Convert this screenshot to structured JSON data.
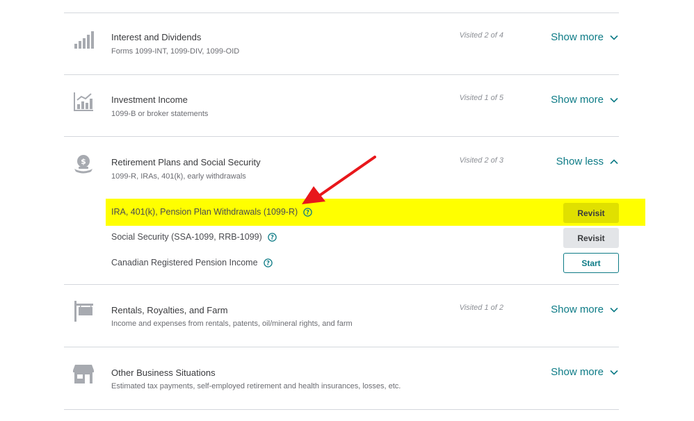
{
  "colors": {
    "accent": "#0d7b86",
    "highlight": "#ffff00",
    "arrow": "#e8171b",
    "divider": "#d4d7dc"
  },
  "sections": [
    {
      "icon": "bar-chart-icon",
      "title": "Interest and Dividends",
      "subtitle": "Forms 1099-INT, 1099-DIV, 1099-OID",
      "visited": "Visited 2 of 4",
      "toggle": "Show more"
    },
    {
      "icon": "investment-chart-icon",
      "title": "Investment Income",
      "subtitle": "1099-B or broker statements",
      "visited": "Visited 1 of 5",
      "toggle": "Show more"
    },
    {
      "icon": "money-bag-icon",
      "title": "Retirement Plans and Social Security",
      "subtitle": "1099-R, IRAs, 401(k), early withdrawals",
      "visited": "Visited 2 of 3",
      "toggle": "Show less",
      "items": [
        {
          "label": "IRA, 401(k), Pension Plan Withdrawals (1099-R)",
          "button": "Revisit",
          "highlighted": true
        },
        {
          "label": "Social Security (SSA-1099, RRB-1099)",
          "button": "Revisit"
        },
        {
          "label": "Canadian Registered Pension Income",
          "button": "Start"
        }
      ]
    },
    {
      "icon": "signpost-icon",
      "title": "Rentals, Royalties, and Farm",
      "subtitle": "Income and expenses from rentals, patents, oil/mineral rights, and farm",
      "visited": "Visited 1 of 2",
      "toggle": "Show more"
    },
    {
      "icon": "storefront-icon",
      "title": "Other Business Situations",
      "subtitle": "Estimated tax payments, self-employed retirement and health insurances, losses, etc.",
      "visited": "",
      "toggle": "Show more"
    }
  ]
}
